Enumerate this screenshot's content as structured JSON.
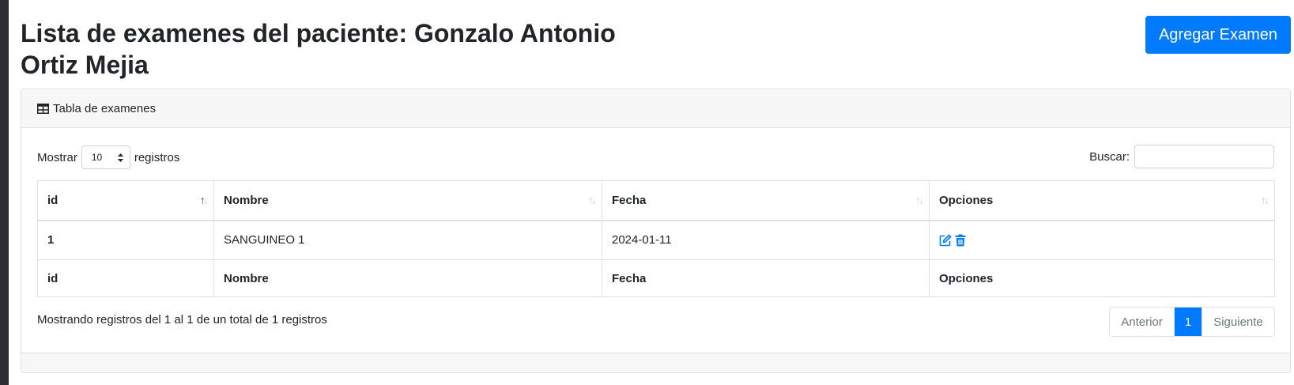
{
  "page": {
    "title": "Lista de examenes del paciente: Gonzalo Antonio Ortiz Mejia",
    "add_button_label": "Agregar Examen"
  },
  "card": {
    "header_label": "Tabla de examenes",
    "header_icon": "table-icon"
  },
  "controls": {
    "length_prefix": "Mostrar",
    "length_value": "10",
    "length_suffix": "registros",
    "search_label": "Buscar:",
    "search_value": ""
  },
  "table": {
    "columns": [
      "id",
      "Nombre",
      "Fecha",
      "Opciones"
    ],
    "sorted_column": "id",
    "rows": [
      {
        "id": "1",
        "nombre": "SANGUINEO 1",
        "fecha": "2024-01-11",
        "options": [
          "edit-icon",
          "trash-icon"
        ]
      }
    ],
    "footer": [
      "id",
      "Nombre",
      "Fecha",
      "Opciones"
    ]
  },
  "info_text": "Mostrando registros del 1 al 1 de un total de 1 registros",
  "pagination": {
    "prev_label": "Anterior",
    "current_page": "1",
    "next_label": "Siguiente"
  },
  "colors": {
    "primary": "#007bff",
    "header_bg": "#f7f7f7",
    "border": "#dee2e6"
  }
}
